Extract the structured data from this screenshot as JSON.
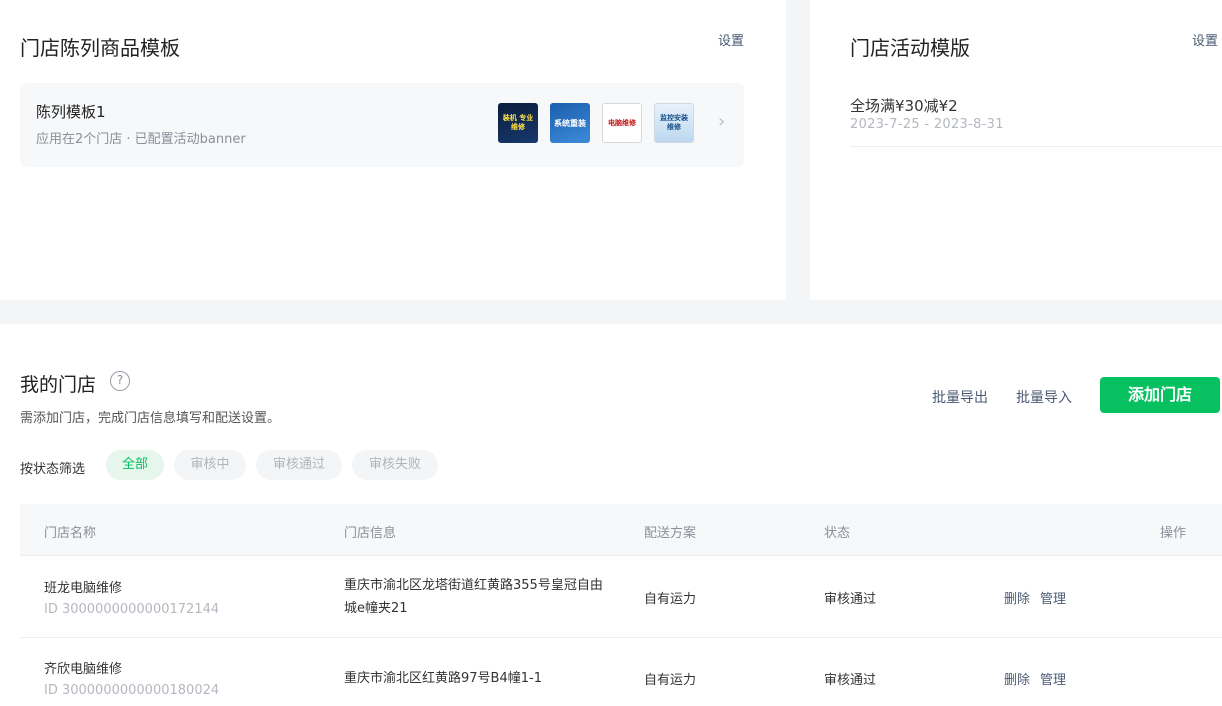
{
  "template_card": {
    "title": "门店陈列商品模板",
    "settings": "设置",
    "item": {
      "name": "陈列模板1",
      "desc": "应用在2个门店 · 已配置活动banner",
      "thumbs": [
        "装机 专业维修",
        "系统重装",
        "电脑维修",
        "监控安装维修"
      ]
    }
  },
  "activity_card": {
    "title": "门店活动模版",
    "settings": "设置",
    "item": {
      "name": "全场满¥30减¥2",
      "date": "2023-7-25 - 2023-8-31"
    }
  },
  "stores": {
    "title": "我的门店",
    "help": "?",
    "desc": "需添加门店，完成门店信息填写和配送设置。",
    "export": "批量导出",
    "import": "批量导入",
    "add": "添加门店",
    "filter_label": "按状态筛选",
    "filters": [
      "全部",
      "审核中",
      "审核通过",
      "审核失败"
    ],
    "columns": [
      "门店名称",
      "门店信息",
      "配送方案",
      "状态",
      "操作"
    ],
    "rows": [
      {
        "name": "班龙电脑维修",
        "id": "ID 3000000000000172144",
        "address": "重庆市渝北区龙塔街道红黄路355号皇冠自由城e幢夹21",
        "delivery": "自有运力",
        "status": "审核通过",
        "delete": "删除",
        "manage": "管理"
      },
      {
        "name": "齐欣电脑维修",
        "id": "ID 3000000000000180024",
        "address": "重庆市渝北区红黄路97号B4幢1-1",
        "delivery": "自有运力",
        "status": "审核通过",
        "delete": "删除",
        "manage": "管理"
      }
    ]
  },
  "colors": {
    "primary": "#07c160",
    "link": "#4a5a73",
    "page_bg": "#f4f5f7"
  }
}
